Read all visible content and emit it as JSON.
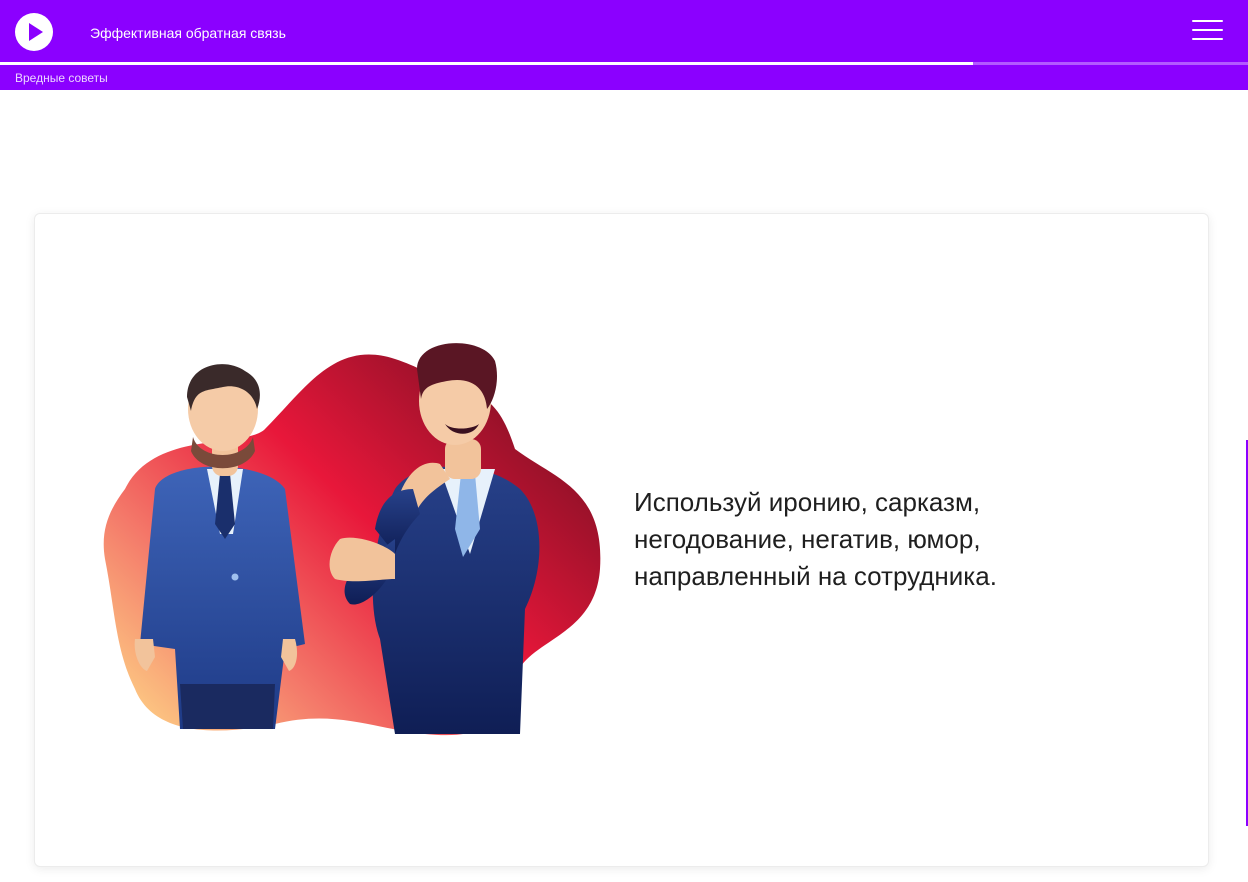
{
  "header": {
    "title": "Эффективная обратная связь",
    "section": "Вредные советы",
    "progress_fraction": 0.78,
    "play_icon": "play-icon",
    "menu_icon": "hamburger-menu-icon",
    "accent_color": "#8b00ff"
  },
  "slide": {
    "text": "Используй иронию, сарказм, негодование, негатив, юмор, направленный на сотрудника.",
    "illustration": "two-businessmen-illustration"
  }
}
